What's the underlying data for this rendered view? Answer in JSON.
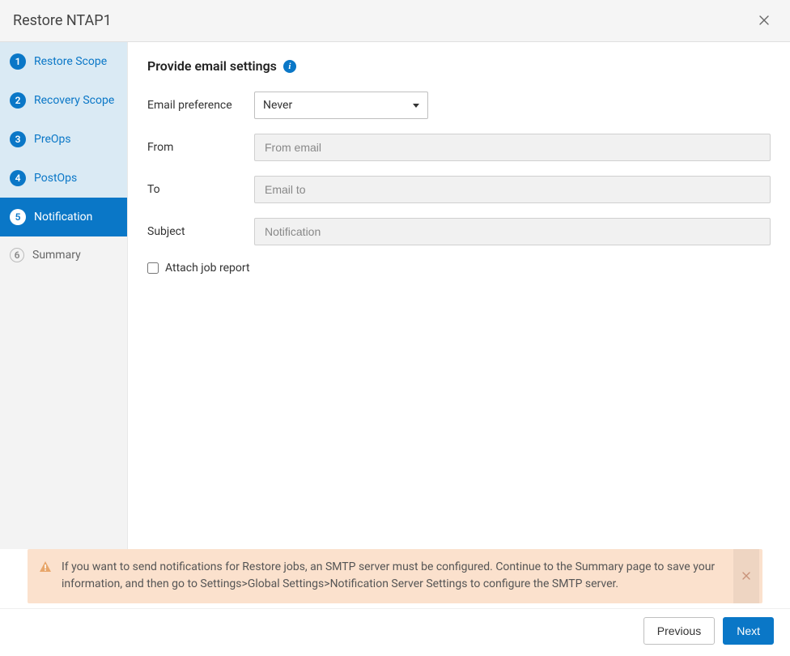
{
  "dialog": {
    "title": "Restore NTAP1"
  },
  "sidebar": {
    "steps": [
      {
        "num": "1",
        "label": "Restore Scope"
      },
      {
        "num": "2",
        "label": "Recovery Scope"
      },
      {
        "num": "3",
        "label": "PreOps"
      },
      {
        "num": "4",
        "label": "PostOps"
      },
      {
        "num": "5",
        "label": "Notification"
      },
      {
        "num": "6",
        "label": "Summary"
      }
    ],
    "active_index": 4
  },
  "main": {
    "heading": "Provide email settings",
    "email_preference_label": "Email preference",
    "email_preference_value": "Never",
    "from_label": "From",
    "from_placeholder": "From email",
    "from_value": "",
    "to_label": "To",
    "to_placeholder": "Email to",
    "to_value": "",
    "subject_label": "Subject",
    "subject_placeholder": "Notification",
    "subject_value": "",
    "attach_label": "Attach job report",
    "attach_checked": false
  },
  "alert": {
    "message": "If you want to send notifications for Restore jobs, an SMTP server must be configured. Continue to the Summary page to save your information, and then go to Settings>Global Settings>Notification Server Settings to configure the SMTP server."
  },
  "footer": {
    "previous_label": "Previous",
    "next_label": "Next"
  }
}
